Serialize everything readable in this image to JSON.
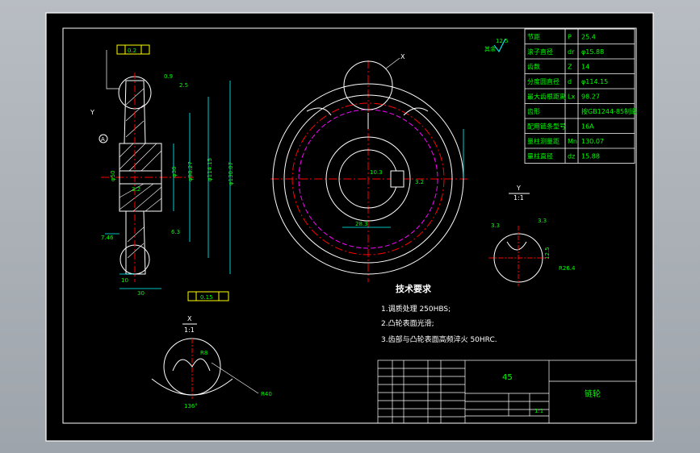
{
  "colors": {
    "background": "#000000",
    "lines": "#ffffff",
    "text": "#00ff00",
    "centerline": "#ff0000",
    "pitch_circle": "#ff00ff",
    "dimension": "#00ffff",
    "highlight": "#ffff00"
  },
  "params": [
    {
      "name": "节距",
      "sym": "P",
      "val": "25.4"
    },
    {
      "name": "滚子直径",
      "sym": "dr",
      "val": "φ15.88"
    },
    {
      "name": "齿数",
      "sym": "Z",
      "val": "14"
    },
    {
      "name": "分度圆直径",
      "sym": "d",
      "val": "φ114.15"
    },
    {
      "name": "最大齿根距离",
      "sym": "Lx",
      "val": "98.27"
    },
    {
      "name": "齿形",
      "sym": "",
      "val": "按GB1244-85制造"
    },
    {
      "name": "配用链条型号",
      "sym": "",
      "val": "16A"
    },
    {
      "name": "量柱测量距",
      "sym": "Mn",
      "val": "130.07"
    },
    {
      "name": "量柱直径",
      "sym": "dz",
      "val": "15.88"
    }
  ],
  "tech_req": {
    "title": "技术要求",
    "items": [
      "1.调质处理 250HBS;",
      "2.凸轮表面光滑;",
      "3.齿部与凸轮表面高频淬火 50HRC."
    ]
  },
  "title_block": {
    "material": "45",
    "name": "链轮",
    "scale": "1:1"
  },
  "views": {
    "detail_x": {
      "label": "X",
      "scale": "1:1",
      "angle": "136°",
      "r": "R40",
      "r2": "R8"
    },
    "detail_y": {
      "label": "Y",
      "scale": "1:1",
      "r": "R26.4",
      "d1": "3.3",
      "d2": "3.3",
      "d3": "12.5"
    },
    "labels": {
      "x": "X",
      "y": "Y",
      "a": "A"
    }
  },
  "dims": {
    "left": {
      "dims1": "30",
      "dims2": "10",
      "dim3": "7.46",
      "dim4": "6.3",
      "dim5": "3.2",
      "dim6": "0.9",
      "dim7": "2.5",
      "dia1": "φ114.15",
      "dia2": "φ130.07",
      "dia3": "φ98.27",
      "dia4": "φ30",
      "dia5": "φ50"
    },
    "tol1": "0.2",
    "tol2": "0.15",
    "center": {
      "a": "28.3",
      "b": "10.3",
      "c": "3.2"
    },
    "roughness": "12.5",
    "rough_label": "其余"
  }
}
